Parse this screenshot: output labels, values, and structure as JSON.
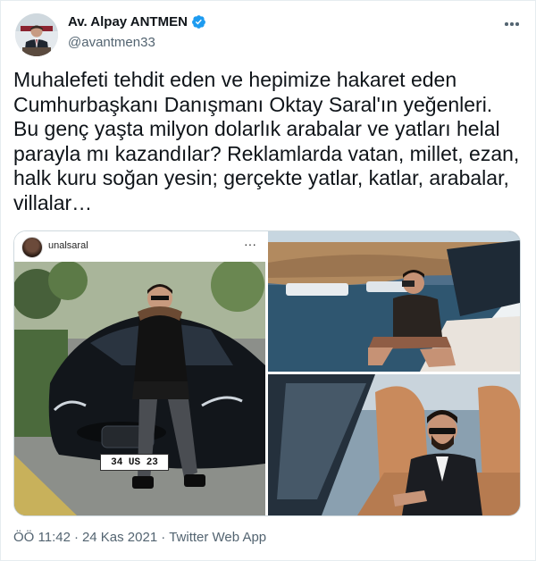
{
  "author": {
    "name": "Av. Alpay ANTMEN",
    "handle": "@avantmen33",
    "avatar_icon": "profile-photo"
  },
  "tweet": {
    "text": "Muhalefeti tehdit eden ve hepimize hakaret eden Cumhurbaşkanı Danışmanı Oktay Saral'ın yeğenleri. Bu genç yaşta milyon dolarlık arabalar ve yatları helal parayla mı kazandılar? Reklamlarda vatan, millet, ezan, halk kuru soğan yesin; gerçekte yatlar, katlar, arabalar, villalar…"
  },
  "media": {
    "left_photo": {
      "instagram_user": "unalsaral",
      "plate": "34 US 23"
    }
  },
  "meta": {
    "time": "ÖÖ 11:42",
    "sep1": "·",
    "date": "24 Kas 2021",
    "sep2": "·",
    "source": "Twitter Web App"
  },
  "colors": {
    "verified": "#1d9bf0",
    "secondary_text": "#536471",
    "primary_text": "#0f1419",
    "border": "#cfd9de"
  }
}
